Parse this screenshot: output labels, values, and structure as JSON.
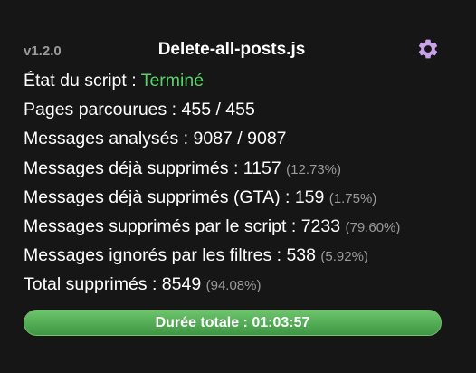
{
  "header": {
    "version": "v1.2.0",
    "title": "Delete-all-posts.js",
    "settings_icon": "gear-icon"
  },
  "status": {
    "label": "État du script : ",
    "value": "Terminé",
    "value_color": "#5cd16a"
  },
  "stats": {
    "pages": "Pages parcourues : 455 / 455",
    "analyzed": "Messages analysés : 9087 / 9087",
    "already_deleted": "Messages déjà supprimés : 1157 ",
    "already_deleted_pct": "(12.73%)",
    "already_deleted_gta": "Messages déjà supprimés (GTA) : 159 ",
    "already_deleted_gta_pct": "(1.75%)",
    "deleted_by_script": "Messages supprimés par le script : 7233 ",
    "deleted_by_script_pct": "(79.60%)",
    "ignored_by_filters": "Messages ignorés par les filtres : 538 ",
    "ignored_by_filters_pct": "(5.92%)",
    "total_deleted": "Total supprimés : 8549 ",
    "total_deleted_pct": "(94.08%)"
  },
  "progress": {
    "label": "Durée totale : 01:03:57",
    "fraction": 1.0,
    "color": "#4f9f50"
  }
}
